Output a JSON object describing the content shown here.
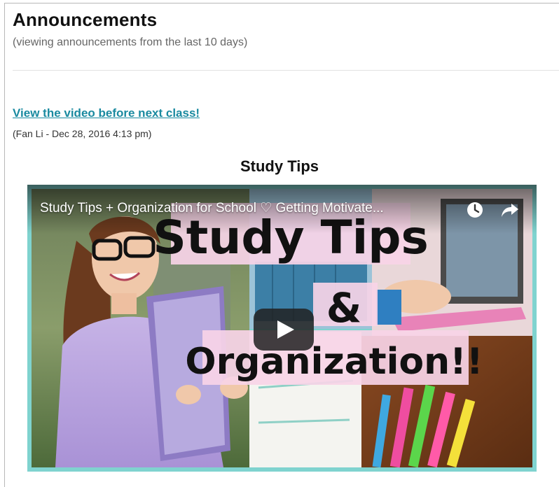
{
  "page": {
    "title": "Announcements",
    "subtitle": "(viewing announcements from the last 10 days)"
  },
  "announcement": {
    "link_text": "View the video before next class!",
    "meta": "(Fan Li - Dec 28, 2016 4:13 pm)",
    "heading": "Study Tips",
    "video": {
      "title": "Study Tips + Organization for School ♡ Getting Motivate...",
      "thumbnail_text": {
        "line1": "Study Tips",
        "line2": "&",
        "line3": "Organization!!"
      },
      "icons": {
        "watch_later": "clock-icon",
        "share": "share-arrow-icon",
        "play": "play-icon"
      }
    }
  },
  "colors": {
    "link": "#1a8aa0",
    "frame_accent": "#7fd3cf",
    "play_button": "#212121"
  }
}
